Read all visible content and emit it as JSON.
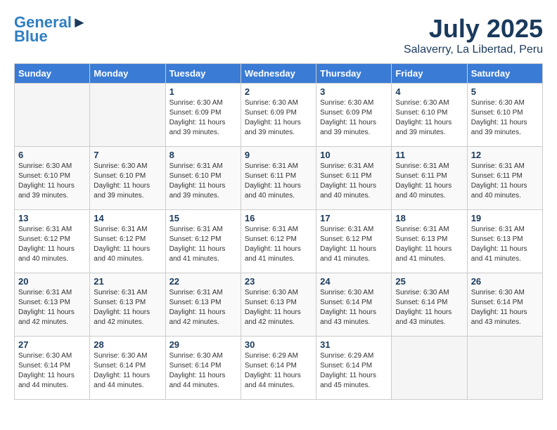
{
  "header": {
    "logo_line1": "General",
    "logo_line2": "Blue",
    "month_year": "July 2025",
    "location": "Salaverry, La Libertad, Peru"
  },
  "days_of_week": [
    "Sunday",
    "Monday",
    "Tuesday",
    "Wednesday",
    "Thursday",
    "Friday",
    "Saturday"
  ],
  "weeks": [
    [
      {
        "day": "",
        "empty": true
      },
      {
        "day": "",
        "empty": true
      },
      {
        "day": "1",
        "info": "Sunrise: 6:30 AM\nSunset: 6:09 PM\nDaylight: 11 hours\nand 39 minutes."
      },
      {
        "day": "2",
        "info": "Sunrise: 6:30 AM\nSunset: 6:09 PM\nDaylight: 11 hours\nand 39 minutes."
      },
      {
        "day": "3",
        "info": "Sunrise: 6:30 AM\nSunset: 6:09 PM\nDaylight: 11 hours\nand 39 minutes."
      },
      {
        "day": "4",
        "info": "Sunrise: 6:30 AM\nSunset: 6:10 PM\nDaylight: 11 hours\nand 39 minutes."
      },
      {
        "day": "5",
        "info": "Sunrise: 6:30 AM\nSunset: 6:10 PM\nDaylight: 11 hours\nand 39 minutes."
      }
    ],
    [
      {
        "day": "6",
        "info": "Sunrise: 6:30 AM\nSunset: 6:10 PM\nDaylight: 11 hours\nand 39 minutes."
      },
      {
        "day": "7",
        "info": "Sunrise: 6:30 AM\nSunset: 6:10 PM\nDaylight: 11 hours\nand 39 minutes."
      },
      {
        "day": "8",
        "info": "Sunrise: 6:31 AM\nSunset: 6:10 PM\nDaylight: 11 hours\nand 39 minutes."
      },
      {
        "day": "9",
        "info": "Sunrise: 6:31 AM\nSunset: 6:11 PM\nDaylight: 11 hours\nand 40 minutes."
      },
      {
        "day": "10",
        "info": "Sunrise: 6:31 AM\nSunset: 6:11 PM\nDaylight: 11 hours\nand 40 minutes."
      },
      {
        "day": "11",
        "info": "Sunrise: 6:31 AM\nSunset: 6:11 PM\nDaylight: 11 hours\nand 40 minutes."
      },
      {
        "day": "12",
        "info": "Sunrise: 6:31 AM\nSunset: 6:11 PM\nDaylight: 11 hours\nand 40 minutes."
      }
    ],
    [
      {
        "day": "13",
        "info": "Sunrise: 6:31 AM\nSunset: 6:12 PM\nDaylight: 11 hours\nand 40 minutes."
      },
      {
        "day": "14",
        "info": "Sunrise: 6:31 AM\nSunset: 6:12 PM\nDaylight: 11 hours\nand 40 minutes."
      },
      {
        "day": "15",
        "info": "Sunrise: 6:31 AM\nSunset: 6:12 PM\nDaylight: 11 hours\nand 41 minutes."
      },
      {
        "day": "16",
        "info": "Sunrise: 6:31 AM\nSunset: 6:12 PM\nDaylight: 11 hours\nand 41 minutes."
      },
      {
        "day": "17",
        "info": "Sunrise: 6:31 AM\nSunset: 6:12 PM\nDaylight: 11 hours\nand 41 minutes."
      },
      {
        "day": "18",
        "info": "Sunrise: 6:31 AM\nSunset: 6:13 PM\nDaylight: 11 hours\nand 41 minutes."
      },
      {
        "day": "19",
        "info": "Sunrise: 6:31 AM\nSunset: 6:13 PM\nDaylight: 11 hours\nand 41 minutes."
      }
    ],
    [
      {
        "day": "20",
        "info": "Sunrise: 6:31 AM\nSunset: 6:13 PM\nDaylight: 11 hours\nand 42 minutes."
      },
      {
        "day": "21",
        "info": "Sunrise: 6:31 AM\nSunset: 6:13 PM\nDaylight: 11 hours\nand 42 minutes."
      },
      {
        "day": "22",
        "info": "Sunrise: 6:31 AM\nSunset: 6:13 PM\nDaylight: 11 hours\nand 42 minutes."
      },
      {
        "day": "23",
        "info": "Sunrise: 6:30 AM\nSunset: 6:13 PM\nDaylight: 11 hours\nand 42 minutes."
      },
      {
        "day": "24",
        "info": "Sunrise: 6:30 AM\nSunset: 6:14 PM\nDaylight: 11 hours\nand 43 minutes."
      },
      {
        "day": "25",
        "info": "Sunrise: 6:30 AM\nSunset: 6:14 PM\nDaylight: 11 hours\nand 43 minutes."
      },
      {
        "day": "26",
        "info": "Sunrise: 6:30 AM\nSunset: 6:14 PM\nDaylight: 11 hours\nand 43 minutes."
      }
    ],
    [
      {
        "day": "27",
        "info": "Sunrise: 6:30 AM\nSunset: 6:14 PM\nDaylight: 11 hours\nand 44 minutes."
      },
      {
        "day": "28",
        "info": "Sunrise: 6:30 AM\nSunset: 6:14 PM\nDaylight: 11 hours\nand 44 minutes."
      },
      {
        "day": "29",
        "info": "Sunrise: 6:30 AM\nSunset: 6:14 PM\nDaylight: 11 hours\nand 44 minutes."
      },
      {
        "day": "30",
        "info": "Sunrise: 6:29 AM\nSunset: 6:14 PM\nDaylight: 11 hours\nand 44 minutes."
      },
      {
        "day": "31",
        "info": "Sunrise: 6:29 AM\nSunset: 6:14 PM\nDaylight: 11 hours\nand 45 minutes."
      },
      {
        "day": "",
        "empty": true
      },
      {
        "day": "",
        "empty": true
      }
    ]
  ]
}
